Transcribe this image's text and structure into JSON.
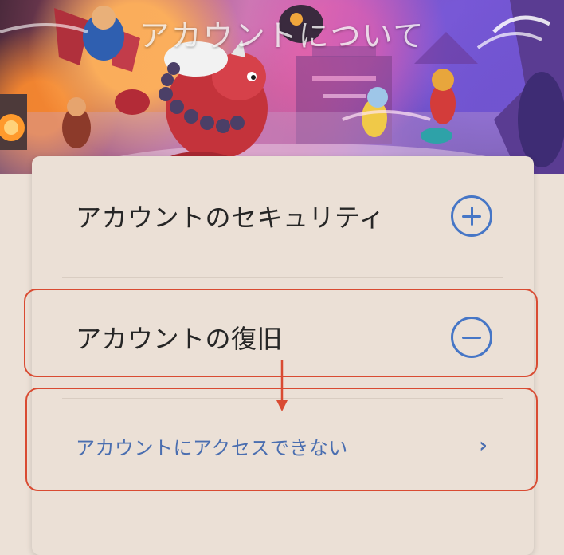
{
  "hero": {
    "title": "アカウントについて"
  },
  "sections": [
    {
      "label": "アカウントのセキュリティ",
      "state": "collapsed",
      "toggle_icon": "plus-circle-icon"
    },
    {
      "label": "アカウントの復旧",
      "state": "expanded",
      "toggle_icon": "minus-circle-icon",
      "items": [
        {
          "label": "アカウントにアクセスできない",
          "icon": "chevron-right-icon",
          "glyph": "›"
        }
      ]
    }
  ],
  "colors": {
    "accent": "#4676c6",
    "link_text": "#4a6eb0",
    "annotation": "#d94b32",
    "background": "#ece1d7"
  }
}
